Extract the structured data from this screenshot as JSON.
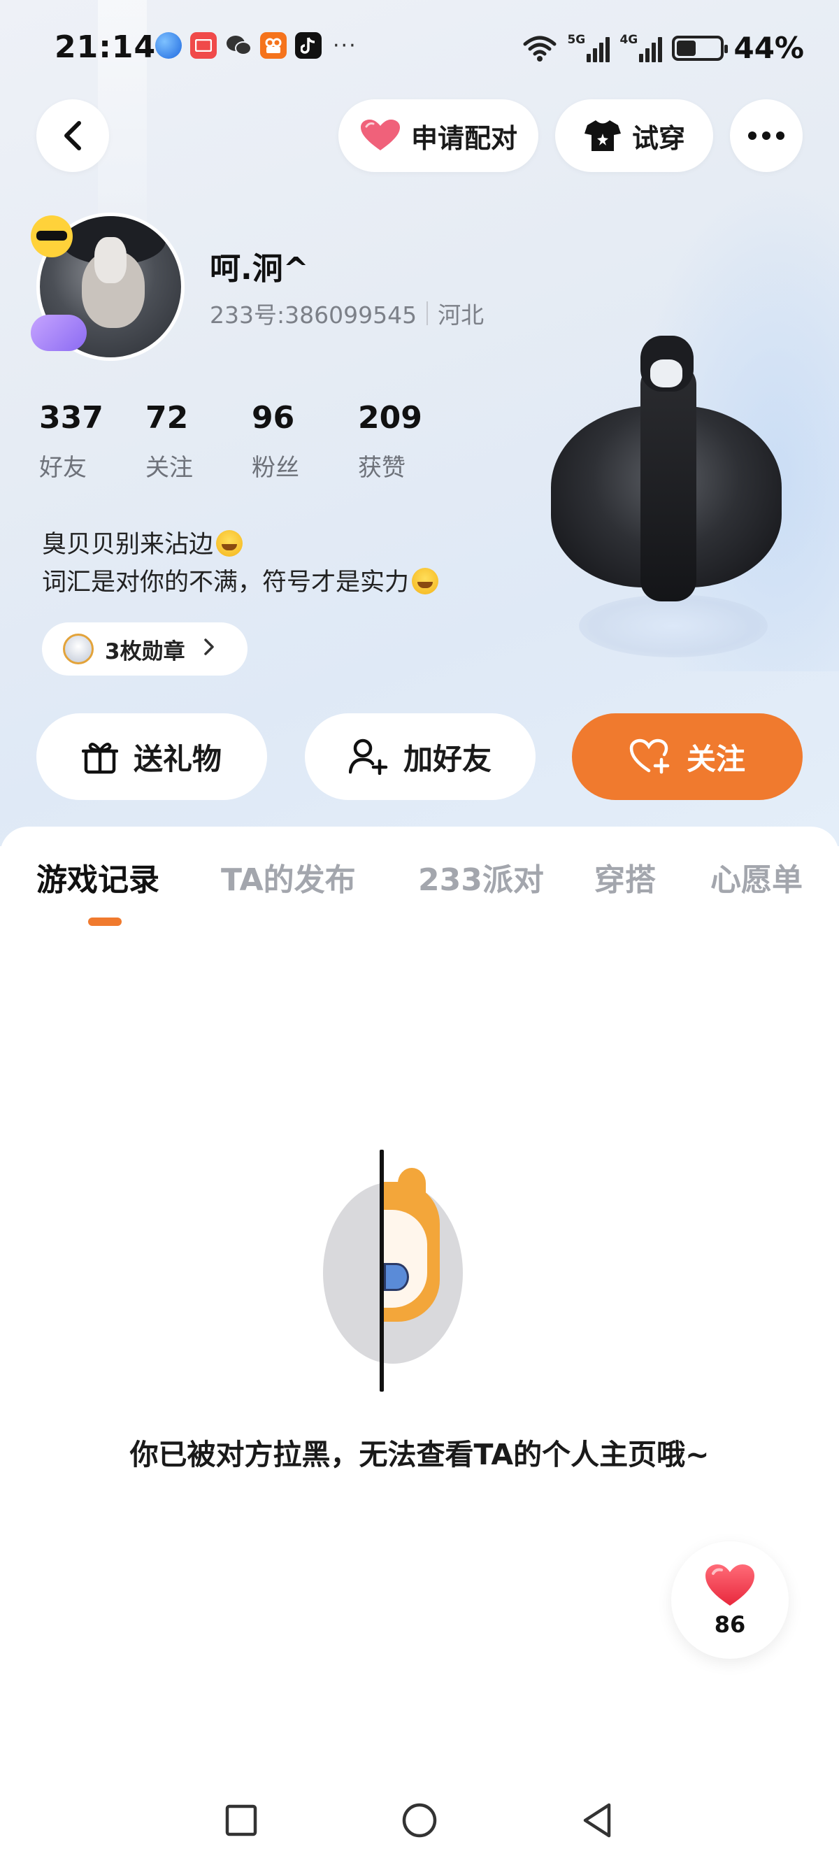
{
  "status_bar": {
    "time": "21:14",
    "notifications": [
      "browser-icon",
      "mail-icon",
      "wechat-icon",
      "kuaishou-icon",
      "tiktok-icon"
    ],
    "more": "···",
    "signal_labels": [
      "5G",
      "4G"
    ],
    "battery_percent": 44,
    "battery_text": "44%"
  },
  "top_nav": {
    "back": "back-arrow-icon",
    "pair_label": "申请配对",
    "try_on_label": "试穿",
    "more": "more-icon"
  },
  "profile": {
    "name": "呵.泂^",
    "uid": "233号:386099545",
    "location": "河北",
    "stats": [
      {
        "value": "337",
        "label": "好友"
      },
      {
        "value": "72",
        "label": "关注"
      },
      {
        "value": "96",
        "label": "粉丝"
      },
      {
        "value": "209",
        "label": "获赞"
      }
    ],
    "bio_line1": "臭贝贝别来沾边",
    "bio_line2": "词汇是对你的不满，符号才是实力",
    "medals_label": "3枚勋章"
  },
  "actions": {
    "gift": "送礼物",
    "add_friend": "加好友",
    "follow": "关注"
  },
  "tabs": [
    {
      "label": "游戏记录",
      "active": true
    },
    {
      "label": "TA的发布",
      "active": false
    },
    {
      "label": "233派对",
      "active": false
    },
    {
      "label": "穿搭",
      "active": false
    },
    {
      "label": "心愿单",
      "active": false
    }
  ],
  "content": {
    "blocked_message": "你已被对方拉黑，无法查看TA的个人主页哦~"
  },
  "like_fab": {
    "count": "86"
  },
  "colors": {
    "accent": "#f07a2e",
    "heart": "#f0455a"
  }
}
